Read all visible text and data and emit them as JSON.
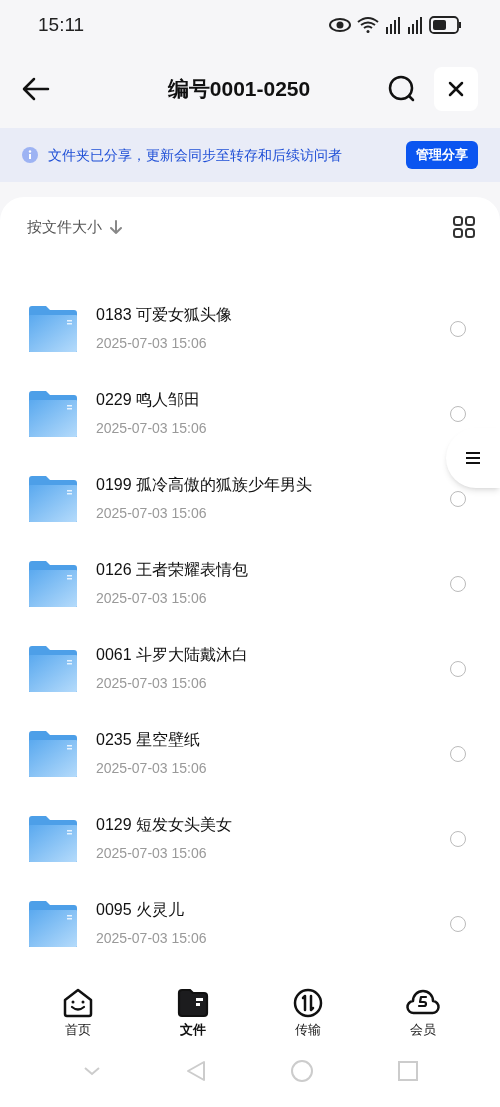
{
  "status_bar": {
    "time": "15:11"
  },
  "header": {
    "title": "编号0001-0250"
  },
  "banner": {
    "message": "文件夹已分享，更新会同步至转存和后续访问者",
    "action": "管理分享"
  },
  "sort": {
    "label": "按文件大小"
  },
  "files": [
    {
      "name": "0183 可爱女狐头像",
      "date": "2025-07-03 15:06",
      "selected": false
    },
    {
      "name": "0229 鸣人邹田",
      "date": "2025-07-03 15:06",
      "selected": false
    },
    {
      "name": "0199 孤冷高傲的狐族少年男头",
      "date": "2025-07-03 15:06",
      "selected": false
    },
    {
      "name": "0126 王者荣耀表情包",
      "date": "2025-07-03 15:06",
      "selected": false
    },
    {
      "name": "0061 斗罗大陆戴沐白",
      "date": "2025-07-03 15:06",
      "selected": false
    },
    {
      "name": "0235 星空壁纸",
      "date": "2025-07-03 15:06",
      "selected": false
    },
    {
      "name": "0129 短发女头美女",
      "date": "2025-07-03 15:06",
      "selected": false
    },
    {
      "name": "0095 火灵儿",
      "date": "2025-07-03 15:06",
      "selected": false
    }
  ],
  "tabs": [
    {
      "kind": "home",
      "label": "首页",
      "selected": false
    },
    {
      "kind": "files",
      "label": "文件",
      "selected": true
    },
    {
      "kind": "transfer",
      "label": "传输",
      "selected": false
    },
    {
      "kind": "vip",
      "label": "会员",
      "selected": false
    }
  ]
}
